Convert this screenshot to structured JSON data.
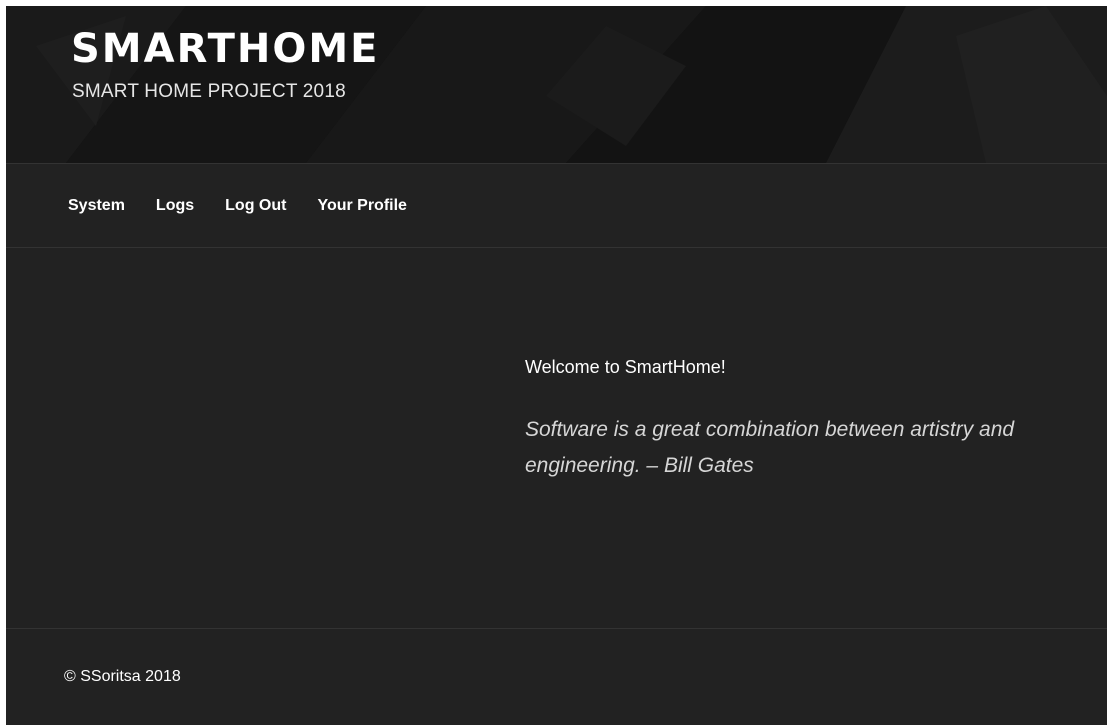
{
  "header": {
    "title": "SMARTHOME",
    "tagline": "SMART HOME PROJECT 2018"
  },
  "nav": {
    "items": [
      {
        "label": "System"
      },
      {
        "label": "Logs"
      },
      {
        "label": "Log Out"
      },
      {
        "label": "Your Profile"
      }
    ]
  },
  "content": {
    "welcome": "Welcome to SmartHome!",
    "quote": "Software is a great combination between artistry and engineering. – Bill Gates"
  },
  "footer": {
    "copyright": "© SSoritsa 2018"
  },
  "colors": {
    "background": "#222222",
    "header_background": "#121212",
    "text": "#ffffff",
    "quote_text": "#d6d6d6",
    "divider": "#333333"
  }
}
